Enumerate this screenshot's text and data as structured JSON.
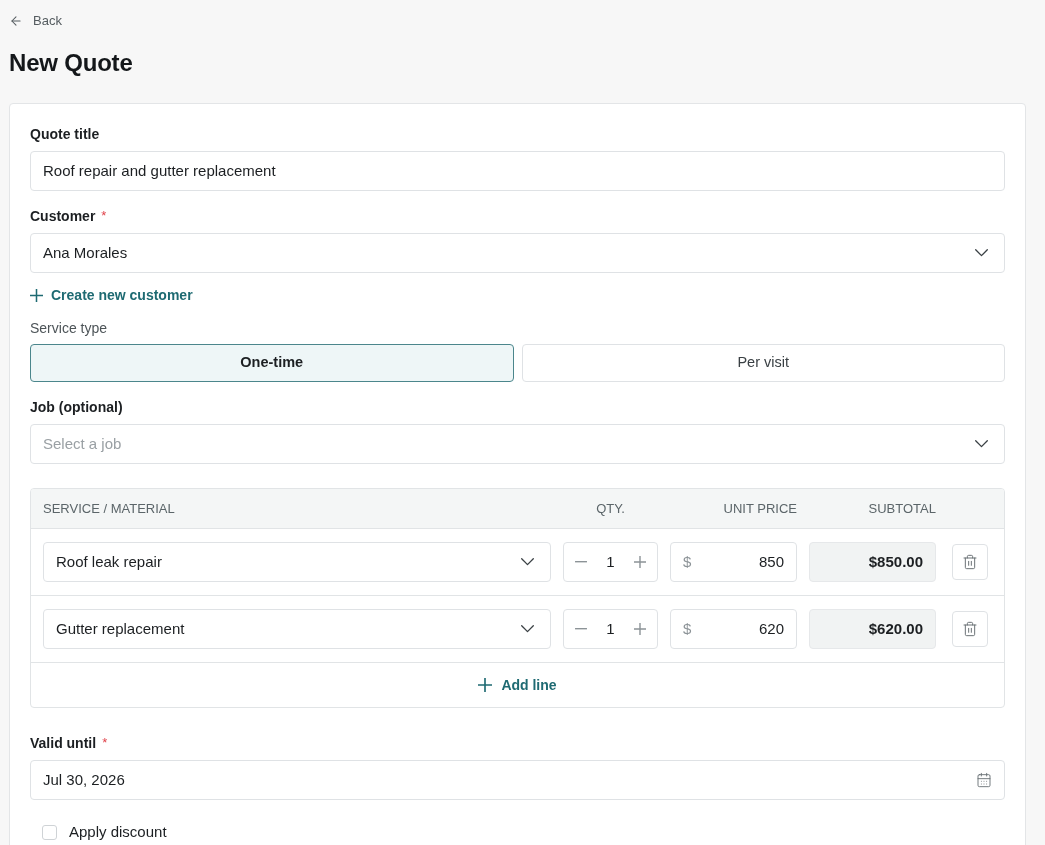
{
  "back_link": {
    "label": "Back"
  },
  "page_title": "New Quote",
  "form": {
    "quote_title": {
      "label": "Quote title",
      "value": "Roof repair and gutter replacement"
    },
    "customer": {
      "label": "Customer",
      "required_mark": "*",
      "value": "Ana Morales"
    },
    "create_customer_link": {
      "label": "Create new customer"
    },
    "service_type": {
      "label": "Service type",
      "options": [
        {
          "label": "One-time",
          "selected": true
        },
        {
          "label": "Per visit",
          "selected": false
        }
      ]
    },
    "job": {
      "label": "Job (optional)",
      "placeholder": "Select a job"
    },
    "line_items": {
      "columns": [
        "SERVICE / MATERIAL",
        "QTY.",
        "UNIT PRICE",
        "SUBTOTAL"
      ],
      "rows": [
        {
          "service": "Roof leak repair",
          "quantity": "1",
          "currency": "$",
          "unit_price": "850",
          "subtotal": "$850.00"
        },
        {
          "service": "Gutter replacement",
          "quantity": "1",
          "currency": "$",
          "unit_price": "620",
          "subtotal": "$620.00"
        }
      ],
      "add_line": {
        "label": "Add line"
      }
    },
    "valid_until": {
      "label": "Valid until",
      "required_mark": "*",
      "value": "Jul 30, 2026"
    },
    "apply_discount": {
      "label": "Apply discount",
      "checked": false
    }
  }
}
